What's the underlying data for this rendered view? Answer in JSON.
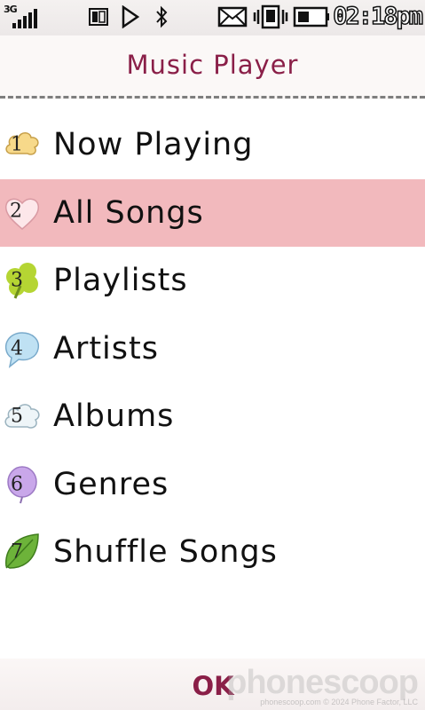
{
  "status_bar": {
    "network": "3G",
    "time": "02:18pm",
    "icons": [
      "signal-icon",
      "sim-icon",
      "play-icon",
      "bluetooth-icon",
      "envelope-icon",
      "vibrate-icon",
      "battery-icon"
    ]
  },
  "header": {
    "title": "Music Player"
  },
  "menu": {
    "selected_index": 1,
    "items": [
      {
        "num": "1",
        "label": "Now Playing",
        "icon": "cloud-icon",
        "color": "#f7d98a"
      },
      {
        "num": "2",
        "label": "All Songs",
        "icon": "heart-icon",
        "color": "#fde7ea"
      },
      {
        "num": "3",
        "label": "Playlists",
        "icon": "clover-icon",
        "color": "#b5d533"
      },
      {
        "num": "4",
        "label": "Artists",
        "icon": "speech-bubble-icon",
        "color": "#bfe1f3"
      },
      {
        "num": "5",
        "label": "Albums",
        "icon": "cloud-icon",
        "color": "#eef5f8"
      },
      {
        "num": "6",
        "label": "Genres",
        "icon": "balloon-icon",
        "color": "#c9a7ea"
      },
      {
        "num": "7",
        "label": "Shuffle Songs",
        "icon": "leaf-icon",
        "color": "#6db33a"
      }
    ]
  },
  "footer": {
    "ok_label": "OK"
  },
  "watermark": {
    "brand": "phonescoop",
    "url": "phonescoop.com",
    "copyright": "© 2024 Phone Factor, LLC"
  },
  "colors": {
    "accent": "#8a1f48",
    "selected_row": "#f2b9bd"
  }
}
